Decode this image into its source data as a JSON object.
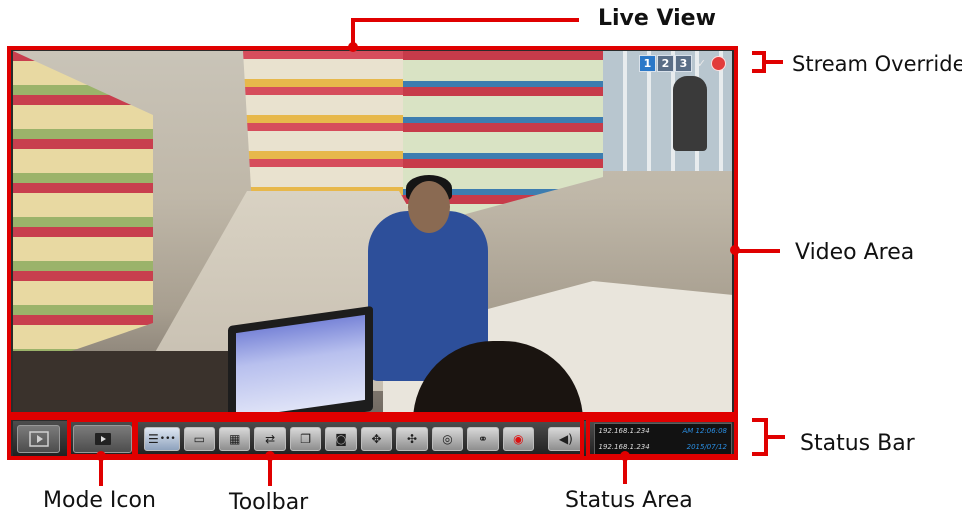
{
  "annotations": {
    "live_view": "Live View",
    "stream_override": "Stream Override",
    "video_area": "Video Area",
    "status_bar": "Status Bar",
    "mode_icon": "Mode Icon",
    "toolbar": "Toolbar",
    "status_area": "Status Area"
  },
  "stream_override": {
    "buttons": [
      "1",
      "2",
      "3",
      "✓"
    ]
  },
  "status_area": {
    "ip_1": "192.168.1.234",
    "time": "AM 12:06:08",
    "ip_2": "192.168.1.234",
    "date": "2015/07/12"
  },
  "toolbar": {
    "icons": [
      "layout-list-icon",
      "monitor-icon",
      "grid-icon",
      "swap-icon",
      "copy-icon",
      "camera-icon",
      "ptz-icon",
      "move-icon",
      "target-icon",
      "link-icon",
      "record-icon"
    ]
  },
  "colors": {
    "annotation": "#e00000",
    "accent_blue": "#2a78c8"
  }
}
